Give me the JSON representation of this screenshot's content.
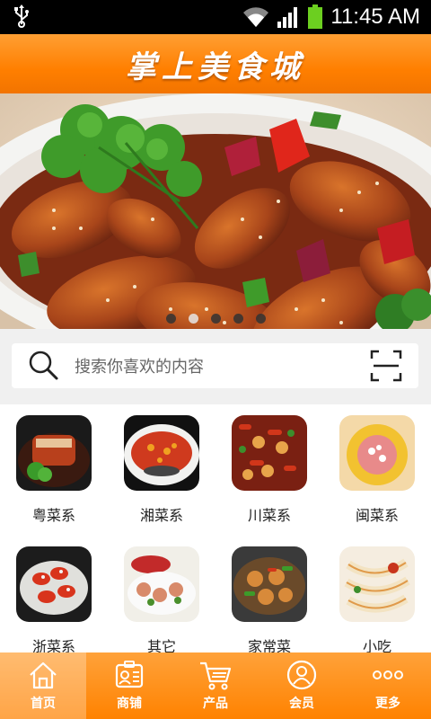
{
  "status_bar": {
    "time": "11:45 AM",
    "icons": [
      "usb-icon",
      "wifi-icon",
      "signal-icon",
      "battery-icon"
    ]
  },
  "app": {
    "title": "掌上美食城",
    "accent_color": "#ff8400"
  },
  "banner": {
    "image": "braised-chicken-wings-photo",
    "dots": 5,
    "active_dot": 2
  },
  "search": {
    "placeholder": "搜索你喜欢的内容",
    "icons": [
      "search-icon",
      "scan-icon"
    ]
  },
  "categories": [
    {
      "label": "粤菜系"
    },
    {
      "label": "湘菜系"
    },
    {
      "label": "川菜系"
    },
    {
      "label": "闽菜系"
    },
    {
      "label": "浙菜系"
    },
    {
      "label": "其它"
    },
    {
      "label": "家常菜"
    },
    {
      "label": "小吃"
    }
  ],
  "bottom_nav": [
    {
      "label": "首页",
      "icon": "home-icon",
      "active": true
    },
    {
      "label": "商铺",
      "icon": "store-icon"
    },
    {
      "label": "产品",
      "icon": "cart-icon"
    },
    {
      "label": "会员",
      "icon": "member-icon"
    },
    {
      "label": "更多",
      "icon": "more-icon"
    }
  ]
}
